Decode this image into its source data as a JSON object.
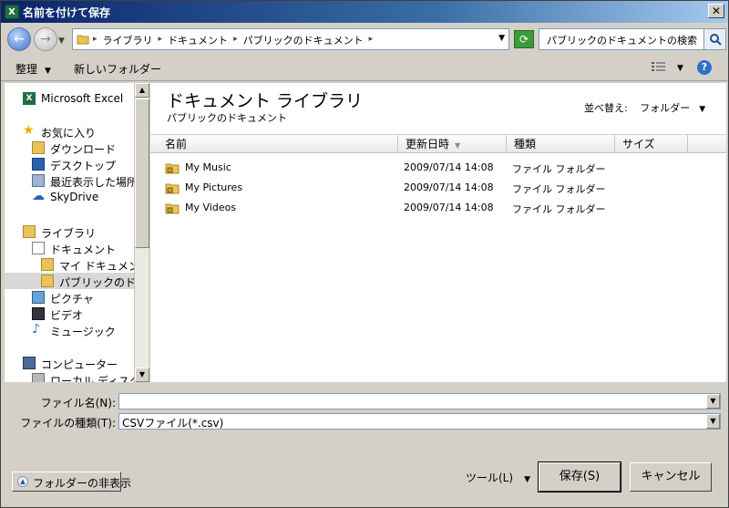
{
  "window": {
    "title": "名前を付けて保存",
    "app_icon_text": "X",
    "close_label": "✕"
  },
  "address": {
    "crumbs": [
      "ライブラリ",
      "ドキュメント",
      "パブリックのドキュメント"
    ]
  },
  "search": {
    "placeholder": "パブリックのドキュメントの検索"
  },
  "toolbar": {
    "organize": "整理",
    "new_folder": "新しいフォルダー",
    "help": "?"
  },
  "nav": {
    "items": [
      {
        "label": "Microsoft Excel",
        "icon": "excel-icon"
      },
      {
        "label": "お気に入り",
        "icon": "star-icon"
      },
      {
        "label": "ダウンロード",
        "icon": "download-folder-icon"
      },
      {
        "label": "デスクトップ",
        "icon": "desktop-icon"
      },
      {
        "label": "最近表示した場所",
        "icon": "recent-places-icon"
      },
      {
        "label": "SkyDrive",
        "icon": "cloud-icon"
      },
      {
        "label": "ライブラリ",
        "icon": "library-icon"
      },
      {
        "label": "ドキュメント",
        "icon": "document-icon"
      },
      {
        "label": "マイ ドキュメント",
        "icon": "folder-icon"
      },
      {
        "label": "パブリックのドキュメント",
        "icon": "folder-icon"
      },
      {
        "label": "ピクチャ",
        "icon": "pictures-icon"
      },
      {
        "label": "ビデオ",
        "icon": "video-icon"
      },
      {
        "label": "ミュージック",
        "icon": "music-icon"
      },
      {
        "label": "コンピューター",
        "icon": "computer-icon"
      },
      {
        "label": "ローカル ディスク (C:)",
        "icon": "disk-icon"
      }
    ]
  },
  "main": {
    "library_title": "ドキュメント ライブラリ",
    "library_subtitle": "パブリックのドキュメント",
    "arrange_label": "並べ替え:",
    "arrange_value": "フォルダー",
    "columns": [
      "名前",
      "更新日時",
      "種類",
      "サイズ"
    ],
    "rows": [
      {
        "name": "My Music",
        "date": "2009/07/14 14:08",
        "type": "ファイル フォルダー"
      },
      {
        "name": "My Pictures",
        "date": "2009/07/14 14:08",
        "type": "ファイル フォルダー"
      },
      {
        "name": "My Videos",
        "date": "2009/07/14 14:08",
        "type": "ファイル フォルダー"
      }
    ]
  },
  "fields": {
    "filename_label": "ファイル名(N):",
    "filename_value": "",
    "filetype_label": "ファイルの種類(T):",
    "filetype_value": "CSVファイル(*.csv)"
  },
  "footer": {
    "hide_folders": "フォルダーの非表示",
    "tools": "ツール(L)",
    "save": "保存(S)",
    "cancel": "キャンセル"
  },
  "colors": {
    "titlebar": "#0a246a",
    "dialog_bg": "#d4d0c8",
    "selection": "#d8d8d8"
  }
}
